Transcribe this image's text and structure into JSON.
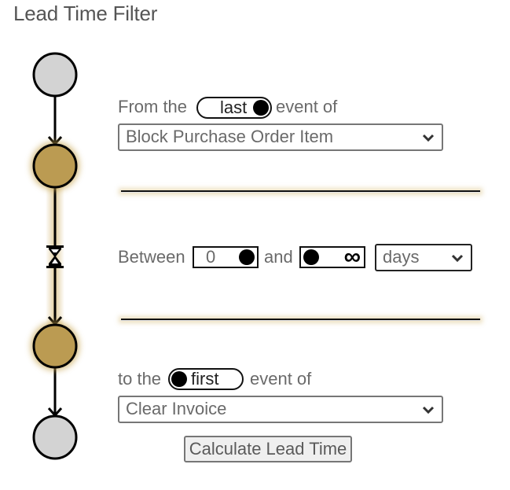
{
  "page": {
    "title": "Lead Time Filter"
  },
  "colors": {
    "gold": "#BB9B52",
    "gray_node": "#D3D3D3",
    "glow": "#C8A550",
    "stroke": "#000000"
  },
  "timeline": {
    "nodes": [
      {
        "name": "start-node",
        "state": "inactive"
      },
      {
        "name": "from-event-node",
        "state": "active"
      },
      {
        "name": "to-event-node",
        "state": "active"
      },
      {
        "name": "end-node",
        "state": "inactive"
      }
    ],
    "duration_icon": "hourglass-icon"
  },
  "from": {
    "prefix": "From the",
    "toggle_label": "last",
    "toggle_value": "last",
    "suffix": "event of",
    "event_selected": "Block Purchase Order Item"
  },
  "between": {
    "prefix": "Between",
    "min_value": "0",
    "conjunction": "and",
    "max_value": "∞",
    "unit_selected": "days"
  },
  "to": {
    "prefix": "to the",
    "toggle_label": "first",
    "toggle_value": "first",
    "suffix": "event of",
    "event_selected": "Clear Invoice"
  },
  "actions": {
    "calculate_label": "Calculate Lead Time"
  }
}
